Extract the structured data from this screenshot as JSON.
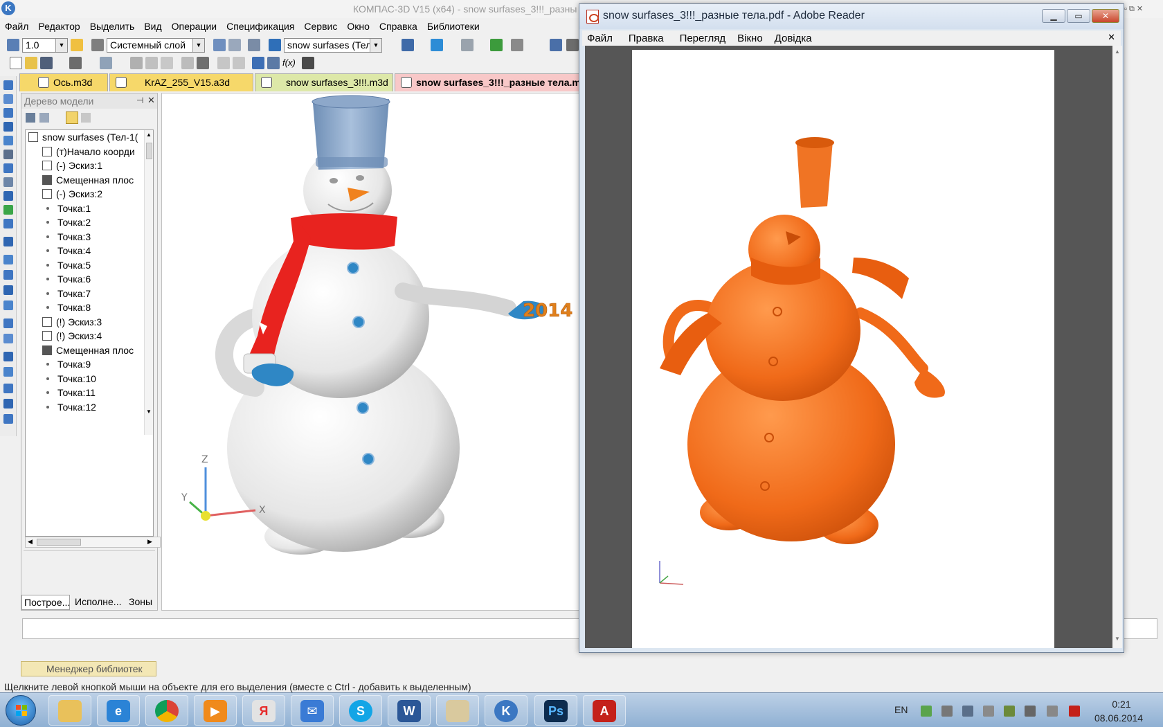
{
  "kompas": {
    "title": "КОМПАС-3D V15 (x64) - snow surfases_3!!!_разны",
    "menu": [
      "Файл",
      "Редактор",
      "Выделить",
      "Вид",
      "Операции",
      "Спецификация",
      "Сервис",
      "Окно",
      "Справка",
      "Библиотеки"
    ],
    "toolbar": {
      "step_value": "1.0",
      "layer_value": "Системный слой",
      "object_value": "snow surfases (Тел"
    },
    "tabs": [
      "Ось.m3d",
      "KrAZ_255_V15.a3d",
      "snow surfases_3!!!.m3d",
      "snow surfases_3!!!_разные тела.m"
    ],
    "tree": {
      "title": "Дерево модели",
      "items": [
        "snow surfases (Тел-1(",
        "(т)Начало коорди",
        "(-) Эскиз:1",
        "Смещенная плос",
        "(-) Эскиз:2",
        "Точка:1",
        "Точка:2",
        "Точка:3",
        "Точка:4",
        "Точка:5",
        "Точка:6",
        "Точка:7",
        "Точка:8",
        "(!) Эскиз:3",
        "(!) Эскиз:4",
        "Смещенная плос",
        "Точка:9",
        "Точка:10",
        "Точка:11",
        "Точка:12"
      ],
      "bottom_tabs": [
        "Построе...",
        "Исполне...",
        "Зоны"
      ]
    },
    "viewport": {
      "year_text": "2014",
      "axis_x": "X",
      "axis_y": "Y",
      "axis_z": "Z"
    },
    "library_manager": "Менеджер библиотек",
    "status_text": "Щелкните левой кнопкой мыши на объекте для его выделения (вместе с Ctrl - добавить к выделенным)"
  },
  "reader": {
    "title": "snow surfases_3!!!_разные тела.pdf - Adobe Reader",
    "menu": [
      "Файл",
      "Правка",
      "Перегляд",
      "Вікно",
      "Довідка"
    ]
  },
  "taskbar": {
    "language": "EN",
    "time": "0:21",
    "date": "08.06.2014"
  },
  "colors": {
    "scarf": "#e8231f",
    "bucket": "#7f9fc4",
    "snow": "#f2f2f2",
    "pdf_model": "#f06a19",
    "button": "#2f87c5"
  }
}
